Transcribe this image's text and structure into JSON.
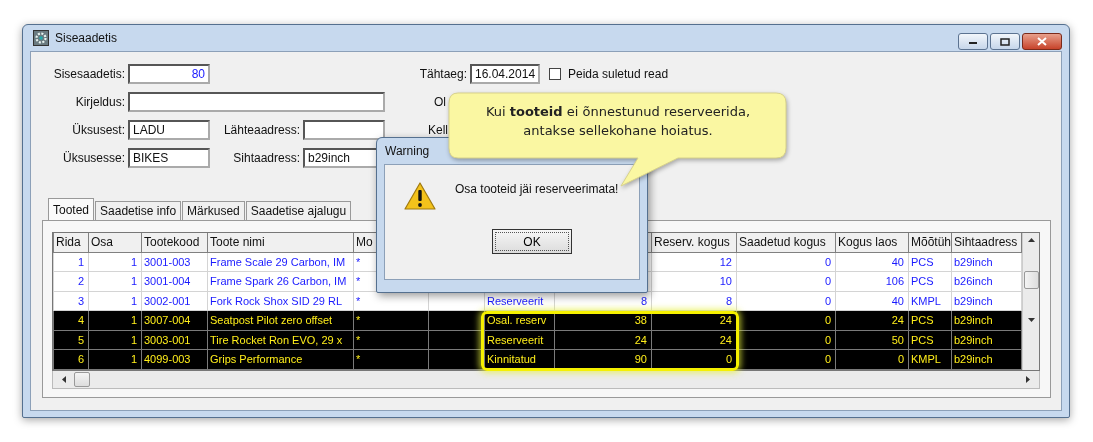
{
  "window": {
    "title": "Siseaadetis"
  },
  "form": {
    "number": {
      "label": "Sisesaadetis:",
      "value": "80"
    },
    "description": {
      "label": "Kirjeldus:"
    },
    "from_unit": {
      "label": "Üksusest:",
      "value": "LADU"
    },
    "to_unit": {
      "label": "Üksusesse:",
      "value": "BIKES"
    },
    "source_address": {
      "label": "Lähteaadress:"
    },
    "target_address": {
      "label": "Sihtaadress:",
      "value": "b29inch"
    },
    "due_date": {
      "label": "Tähtaeg:",
      "value": "16.04.2014"
    },
    "hide_closed": {
      "label": "Peida suletud read",
      "checked": false
    },
    "status": {
      "label": "Ol"
    },
    "time": {
      "label": "Kell"
    }
  },
  "tabs": [
    {
      "label": "Tooted",
      "selected": true
    },
    {
      "label": "Saadetise info",
      "selected": false
    },
    {
      "label": "Märkused",
      "selected": false
    },
    {
      "label": "Saadetise ajalugu",
      "selected": false
    }
  ],
  "table": {
    "columns": [
      "Rida",
      "Osa",
      "Tootekood",
      "Toote nimi",
      "Mo",
      null,
      null,
      null,
      "Reserv. kogus",
      "Saadetud kogus",
      "Kogus laos",
      "Mõõtüh",
      "Sihtaadress"
    ],
    "rows": [
      {
        "selected": false,
        "cells": [
          "1",
          "1",
          "3001-003",
          "Frame Scale 29 Carbon, IM",
          "*",
          null,
          null,
          null,
          "12",
          "0",
          "40",
          "PCS",
          "b29inch"
        ]
      },
      {
        "selected": false,
        "cells": [
          "2",
          "1",
          "3001-004",
          "Frame Spark 26 Carbon, IM",
          "*",
          null,
          null,
          null,
          "10",
          "0",
          "106",
          "PCS",
          "b26inch"
        ]
      },
      {
        "selected": false,
        "cells": [
          "3",
          "1",
          "3002-001",
          "Fork Rock Shox SID 29 RL",
          "*",
          null,
          "Reserveerit",
          "8",
          "8",
          "0",
          "40",
          "KMPL",
          "b29inch"
        ]
      },
      {
        "selected": true,
        "cells": [
          "4",
          "1",
          "3007-004",
          "Seatpost Pilot zero offset",
          "*",
          null,
          "Osal. reserv",
          "38",
          "24",
          "0",
          "24",
          "PCS",
          "b29inch"
        ]
      },
      {
        "selected": true,
        "cells": [
          "5",
          "1",
          "3003-001",
          "Tire Rocket Ron EVO, 29 x",
          "*",
          null,
          "Reserveerit",
          "24",
          "24",
          "0",
          "50",
          "PCS",
          "b29inch"
        ]
      },
      {
        "selected": true,
        "cells": [
          "6",
          "1",
          "4099-003",
          "Grips Performance",
          "*",
          null,
          "Kinnitatud",
          "90",
          "0",
          "0",
          "0",
          "KMPL",
          "b29inch"
        ]
      }
    ]
  },
  "dialog": {
    "title": "Warning",
    "message": "Osa tooteid jäi reserveerimata!",
    "button": "OK"
  },
  "callout": {
    "text": "Kui **tooteid** ei õnnestunud reserveerida, antakse sellekohane hoiatus."
  }
}
